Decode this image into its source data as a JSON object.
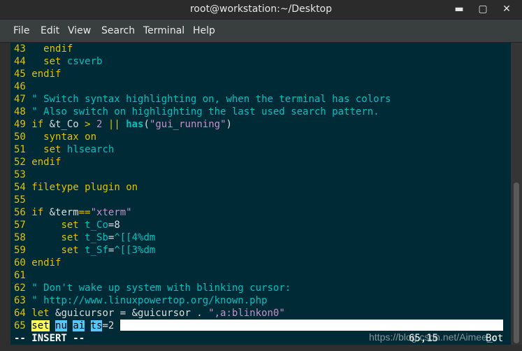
{
  "window": {
    "title": "root@workstation:~/Desktop",
    "minimize": "▬",
    "maximize": "▢",
    "close": "✕"
  },
  "menu": [
    "File",
    "Edit",
    "View",
    "Search",
    "Terminal",
    "Help"
  ],
  "editor": {
    "lines": [
      {
        "n": "43",
        "segs": [
          [
            "plain",
            "   "
          ],
          [
            "kw",
            "endif"
          ]
        ]
      },
      {
        "n": "44",
        "segs": [
          [
            "plain",
            "   "
          ],
          [
            "kw",
            "set"
          ],
          [
            "plain",
            " "
          ],
          [
            "id",
            "csverb"
          ]
        ]
      },
      {
        "n": "45",
        "segs": [
          [
            "plain",
            " "
          ],
          [
            "kw",
            "endif"
          ]
        ]
      },
      {
        "n": "46",
        "segs": []
      },
      {
        "n": "47",
        "segs": [
          [
            "plain",
            " "
          ],
          [
            "cm",
            "\" Switch syntax highlighting on, when the terminal has colors"
          ]
        ]
      },
      {
        "n": "48",
        "segs": [
          [
            "plain",
            " "
          ],
          [
            "cm",
            "\" Also switch on highlighting the last used search pattern."
          ]
        ]
      },
      {
        "n": "49",
        "segs": [
          [
            "plain",
            " "
          ],
          [
            "kw",
            "if"
          ],
          [
            "plain",
            " &t_Co "
          ],
          [
            "op",
            ">"
          ],
          [
            "plain",
            " "
          ],
          [
            "num",
            "2"
          ],
          [
            "plain",
            " "
          ],
          [
            "op",
            "||"
          ],
          [
            "plain",
            " "
          ],
          [
            "fnb",
            "has"
          ],
          [
            "plain",
            "("
          ],
          [
            "str",
            "\"gui_running\""
          ],
          [
            "plain",
            ")"
          ]
        ]
      },
      {
        "n": "50",
        "segs": [
          [
            "plain",
            "   "
          ],
          [
            "kw",
            "syntax"
          ],
          [
            "plain",
            " "
          ],
          [
            "kw",
            "on"
          ]
        ]
      },
      {
        "n": "51",
        "segs": [
          [
            "plain",
            "   "
          ],
          [
            "kw",
            "set"
          ],
          [
            "plain",
            " "
          ],
          [
            "id",
            "hlsearch"
          ]
        ]
      },
      {
        "n": "52",
        "segs": [
          [
            "plain",
            " "
          ],
          [
            "kw",
            "endif"
          ]
        ]
      },
      {
        "n": "53",
        "segs": []
      },
      {
        "n": "54",
        "segs": [
          [
            "plain",
            " "
          ],
          [
            "kw",
            "filetype"
          ],
          [
            "plain",
            " "
          ],
          [
            "kw",
            "plugin"
          ],
          [
            "plain",
            " "
          ],
          [
            "kw",
            "on"
          ]
        ]
      },
      {
        "n": "55",
        "segs": []
      },
      {
        "n": "56",
        "segs": [
          [
            "plain",
            " "
          ],
          [
            "kw",
            "if"
          ],
          [
            "plain",
            " &term"
          ],
          [
            "op",
            "=="
          ],
          [
            "str",
            "\"xterm\""
          ]
        ]
      },
      {
        "n": "57",
        "segs": [
          [
            "plain",
            "      "
          ],
          [
            "kw",
            "set"
          ],
          [
            "plain",
            " "
          ],
          [
            "id",
            "t_Co"
          ],
          [
            "plain",
            "=8"
          ]
        ]
      },
      {
        "n": "58",
        "segs": [
          [
            "plain",
            "      "
          ],
          [
            "kw",
            "set"
          ],
          [
            "plain",
            " "
          ],
          [
            "id",
            "t_Sb"
          ],
          [
            "plain",
            "="
          ],
          [
            "id",
            "^[[4%dm"
          ]
        ]
      },
      {
        "n": "59",
        "segs": [
          [
            "plain",
            "      "
          ],
          [
            "kw",
            "set"
          ],
          [
            "plain",
            " "
          ],
          [
            "id",
            "t_Sf"
          ],
          [
            "plain",
            "="
          ],
          [
            "id",
            "^[[3%dm"
          ]
        ]
      },
      {
        "n": "60",
        "segs": [
          [
            "plain",
            " "
          ],
          [
            "kw",
            "endif"
          ]
        ]
      },
      {
        "n": "61",
        "segs": []
      },
      {
        "n": "62",
        "segs": [
          [
            "plain",
            " "
          ],
          [
            "cm",
            "\" Don't wake up system with blinking cursor:"
          ]
        ]
      },
      {
        "n": "63",
        "segs": [
          [
            "plain",
            " "
          ],
          [
            "cm",
            "\" http://www.linuxpowertop.org/known.php"
          ]
        ]
      },
      {
        "n": "64",
        "segs": [
          [
            "plain",
            " "
          ],
          [
            "kw",
            "let"
          ],
          [
            "plain",
            " &guicursor = &guicursor . "
          ],
          [
            "str",
            "\",a:blinkon0\""
          ]
        ]
      }
    ],
    "current_line": {
      "n": "65",
      "cmd": "set",
      "opt1": "nu",
      "opt2": "ai",
      "opt3": "ts",
      "val": "=2"
    },
    "mode": "-- INSERT --",
    "ruler": "65,15",
    "position": "Bot"
  },
  "watermark": "https://blog.csdn.net/Aimee_c"
}
